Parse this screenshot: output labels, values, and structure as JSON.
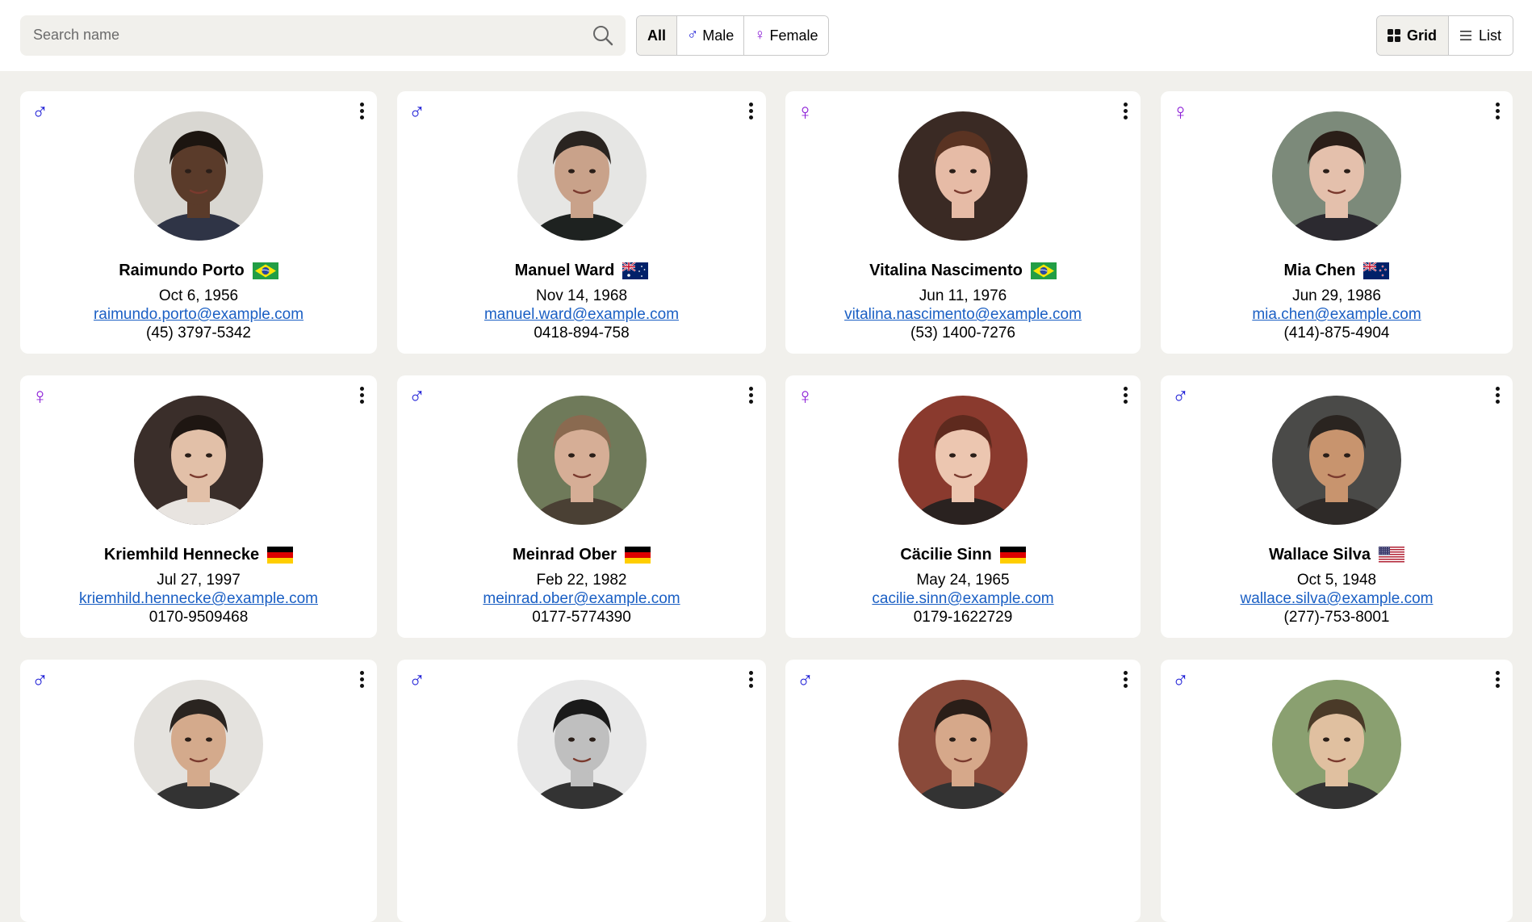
{
  "search": {
    "placeholder": "Search name"
  },
  "filters": {
    "all_label": "All",
    "male_label": "Male",
    "female_label": "Female",
    "male_symbol": "♂",
    "female_symbol": "♀",
    "active": "All"
  },
  "view": {
    "grid_label": "Grid",
    "list_label": "List",
    "active": "Grid"
  },
  "colors": {
    "male": "#1a1ad6",
    "female": "#8a1ad6",
    "link": "#1a5fc4",
    "background": "#f1f0ec"
  },
  "people": [
    {
      "gender": "male",
      "gender_symbol": "♂",
      "name": "Raimundo Porto",
      "country": "BR",
      "dob": "Oct 6, 1956",
      "email": "raimundo.porto@example.com",
      "phone": "(45) 3797-5342",
      "bg": "#d9d7d2",
      "hair": "#1c1510",
      "skin": "#5a3b2a",
      "shirt": "#2f3446"
    },
    {
      "gender": "male",
      "gender_symbol": "♂",
      "name": "Manuel Ward",
      "country": "AU",
      "dob": "Nov 14, 1968",
      "email": "manuel.ward@example.com",
      "phone": "0418-894-758",
      "bg": "#e6e6e4",
      "hair": "#2a2420",
      "skin": "#c9a28a",
      "shirt": "#1e2220"
    },
    {
      "gender": "female",
      "gender_symbol": "♀",
      "name": "Vitalina Nascimento",
      "country": "BR",
      "dob": "Jun 11, 1976",
      "email": "vitalina.nascimento@example.com",
      "phone": "(53) 1400-7276",
      "bg": "#3a2a24",
      "hair": "#5a3322",
      "skin": "#e6bba6",
      "shirt": "#3a2a24"
    },
    {
      "gender": "female",
      "gender_symbol": "♀",
      "name": "Mia Chen",
      "country": "NZ",
      "dob": "Jun 29, 1986",
      "email": "mia.chen@example.com",
      "phone": "(414)-875-4904",
      "bg": "#7c8a7a",
      "hair": "#2a1e18",
      "skin": "#e4c0ac",
      "shirt": "#2c2a30"
    },
    {
      "gender": "female",
      "gender_symbol": "♀",
      "name": "Kriemhild Hennecke",
      "country": "DE",
      "dob": "Jul 27, 1997",
      "email": "kriemhild.hennecke@example.com",
      "phone": "0170-9509468",
      "bg": "#3a2e2a",
      "hair": "#1e1612",
      "skin": "#e2c0a8",
      "shirt": "#e8e4e0"
    },
    {
      "gender": "male",
      "gender_symbol": "♂",
      "name": "Meinrad Ober",
      "country": "DE",
      "dob": "Feb 22, 1982",
      "email": "meinrad.ober@example.com",
      "phone": "0177-5774390",
      "bg": "#6f7a5a",
      "hair": "#8a6a50",
      "skin": "#d6ae96",
      "shirt": "#4a4034"
    },
    {
      "gender": "female",
      "gender_symbol": "♀",
      "name": "Cäcilie Sinn",
      "country": "DE",
      "dob": "May 24, 1965",
      "email": "cacilie.sinn@example.com",
      "phone": "0179-1622729",
      "bg": "#8a3a2e",
      "hair": "#5e2a1e",
      "skin": "#ecc6b0",
      "shirt": "#2a2220"
    },
    {
      "gender": "male",
      "gender_symbol": "♂",
      "name": "Wallace Silva",
      "country": "US",
      "dob": "Oct 5, 1948",
      "email": "wallace.silva@example.com",
      "phone": "(277)-753-8001",
      "bg": "#4a4a48",
      "hair": "#2a2420",
      "skin": "#c8946e",
      "shirt": "#2e2a28"
    },
    {
      "gender": "male",
      "gender_symbol": "♂",
      "name": "",
      "country": "",
      "dob": "",
      "email": "",
      "phone": "",
      "bg": "#e4e2de",
      "hair": "#2a2420",
      "skin": "#d4aa8c",
      "shirt": "#333"
    },
    {
      "gender": "male",
      "gender_symbol": "♂",
      "name": "",
      "country": "",
      "dob": "",
      "email": "",
      "phone": "",
      "bg": "#e8e8e8",
      "hair": "#1a1a1a",
      "skin": "#bfbfbf",
      "shirt": "#333"
    },
    {
      "gender": "male",
      "gender_symbol": "♂",
      "name": "",
      "country": "",
      "dob": "",
      "email": "",
      "phone": "",
      "bg": "#8a4a3a",
      "hair": "#2a1e18",
      "skin": "#d6a88a",
      "shirt": "#333"
    },
    {
      "gender": "male",
      "gender_symbol": "♂",
      "name": "",
      "country": "",
      "dob": "",
      "email": "",
      "phone": "",
      "bg": "#8aa070",
      "hair": "#4a3a28",
      "skin": "#e0c0a0",
      "shirt": "#333"
    }
  ]
}
